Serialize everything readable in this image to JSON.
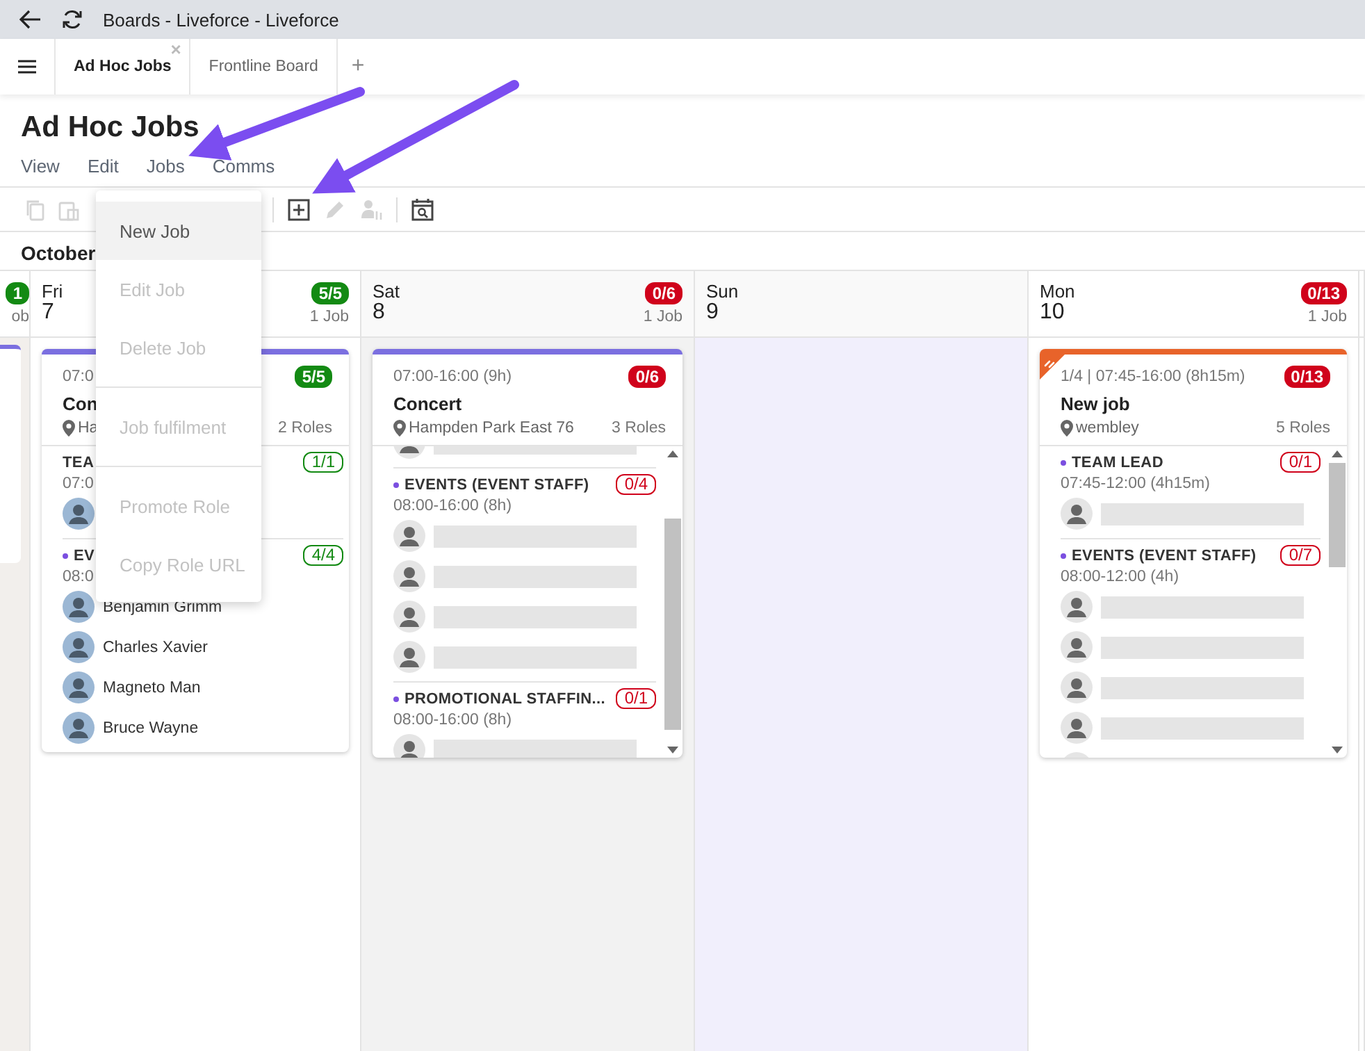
{
  "window": {
    "title": "Boards - Liveforce - Liveforce"
  },
  "tabs": [
    {
      "label": "Ad Hoc Jobs",
      "selected": true,
      "close": "×"
    },
    {
      "label": "Frontline Board",
      "selected": false
    }
  ],
  "new_tab": "+",
  "page_title": "Ad Hoc Jobs",
  "menu_bar": [
    "View",
    "Edit",
    "Jobs",
    "Comms"
  ],
  "jobs_menu": [
    {
      "label": "New Job",
      "disabled": false,
      "highlighted": true,
      "divider_after": false
    },
    {
      "label": "Edit Job",
      "disabled": true,
      "highlighted": false,
      "divider_after": false
    },
    {
      "label": "Delete Job",
      "disabled": true,
      "highlighted": false,
      "divider_after": true
    },
    {
      "label": "Job fulfilment",
      "disabled": true,
      "highlighted": false,
      "divider_after": true
    },
    {
      "label": "Promote Role",
      "disabled": true,
      "highlighted": false,
      "divider_after": false
    },
    {
      "label": "Copy Role URL",
      "disabled": true,
      "highlighted": false,
      "divider_after": false
    }
  ],
  "month": "October",
  "days": [
    {
      "kind": "partial",
      "badge": "1",
      "complete": true,
      "jobs": "ob"
    },
    {
      "kind": "day",
      "name": "Fri",
      "number": "7",
      "badge": "5/5",
      "complete": true,
      "jobs": "1 Job",
      "cards": [
        {
          "time": "07:0",
          "badge": "5/5",
          "complete": true,
          "title": "Con",
          "location": "Ha",
          "roles_count": "2 Roles",
          "linked": false,
          "scrolling": false,
          "roles": [
            {
              "name": "TEA",
              "bullet": false,
              "count": "1/1",
              "complete": true,
              "time": "07:0",
              "slots": [
                {
                  "kind": "person"
                }
              ]
            },
            {
              "name": "EV",
              "bullet": true,
              "count": "4/4",
              "complete": true,
              "time": "08:0",
              "slots": [
                {
                  "kind": "person",
                  "name": "Benjamin Grimm"
                },
                {
                  "kind": "person",
                  "name": "Charles Xavier"
                },
                {
                  "kind": "person",
                  "name": "Magneto Man"
                },
                {
                  "kind": "person",
                  "name": "Bruce Wayne"
                }
              ]
            }
          ]
        }
      ]
    },
    {
      "kind": "day",
      "name": "Sat",
      "number": "8",
      "badge": "0/6",
      "complete": false,
      "jobs": "1 Job",
      "weekend": true,
      "cards": [
        {
          "time": "07:00-16:00 (9h)",
          "badge": "0/6",
          "complete": false,
          "title": "Concert",
          "location": "Hampden Park East 76",
          "roles_count": "3 Roles",
          "linked": false,
          "scrolling": true,
          "lead_slot": true,
          "roles": [
            {
              "name": "EVENTS (EVENT STAFF)",
              "bullet": true,
              "count": "0/4",
              "complete": false,
              "time": "08:00-16:00 (8h)",
              "slots": [
                {
                  "kind": "empty"
                },
                {
                  "kind": "empty"
                },
                {
                  "kind": "empty"
                },
                {
                  "kind": "empty"
                }
              ]
            },
            {
              "name": "PROMOTIONAL STAFFIN...",
              "bullet": true,
              "count": "0/1",
              "complete": false,
              "time": "08:00-16:00 (8h)",
              "slots": [
                {
                  "kind": "empty"
                }
              ]
            }
          ]
        }
      ]
    },
    {
      "kind": "day",
      "name": "Sun",
      "number": "9",
      "highlighted": true
    },
    {
      "kind": "day",
      "name": "Mon",
      "number": "10",
      "badge": "0/13",
      "complete": false,
      "jobs": "1 Job",
      "cards": [
        {
          "time": "1/4 | 07:45-16:00 (8h15m)",
          "badge": "0/13",
          "complete": false,
          "title": "New job",
          "location": "wembley",
          "roles_count": "5 Roles",
          "linked": true,
          "scrolling": true,
          "lead_slot": false,
          "roles": [
            {
              "name": "TEAM LEAD",
              "bullet": true,
              "count": "0/1",
              "complete": false,
              "time": "07:45-12:00 (4h15m)",
              "slots": [
                {
                  "kind": "empty"
                }
              ]
            },
            {
              "name": "EVENTS (EVENT STAFF)",
              "bullet": true,
              "count": "0/7",
              "complete": false,
              "time": "08:00-12:00 (4h)",
              "slots": [
                {
                  "kind": "empty"
                },
                {
                  "kind": "empty"
                },
                {
                  "kind": "empty"
                },
                {
                  "kind": "empty"
                },
                {
                  "kind": "empty"
                }
              ]
            }
          ]
        }
      ]
    },
    {
      "kind": "edge"
    }
  ]
}
